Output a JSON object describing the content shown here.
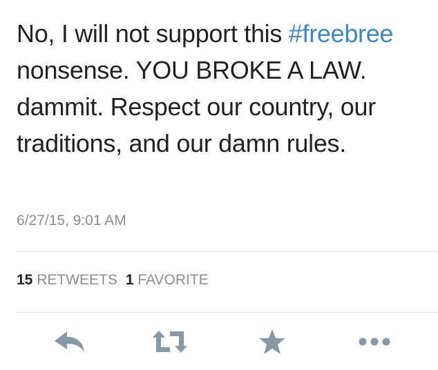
{
  "tweet": {
    "text_before": "No, I will not support this ",
    "hashtag": "#freebree",
    "text_after": " nonsense. YOU BROKE A LAW. dammit. Respect our country, our traditions, and our damn rules.",
    "timestamp": "6/27/15, 9:01 AM"
  },
  "stats": {
    "retweets_count": "15",
    "retweets_label": "RETWEETS",
    "favorites_count": "1",
    "favorites_label": "FAVORITE"
  },
  "actions": {
    "reply_icon": "reply-icon",
    "retweet_icon": "retweet-icon",
    "favorite_icon": "star-icon",
    "more_icon": "more-icon"
  },
  "colors": {
    "text": "#222222",
    "hashtag": "#3b88c3",
    "meta": "#8b8f94",
    "icon": "#8899a6",
    "divider": "#e1e4e7"
  }
}
